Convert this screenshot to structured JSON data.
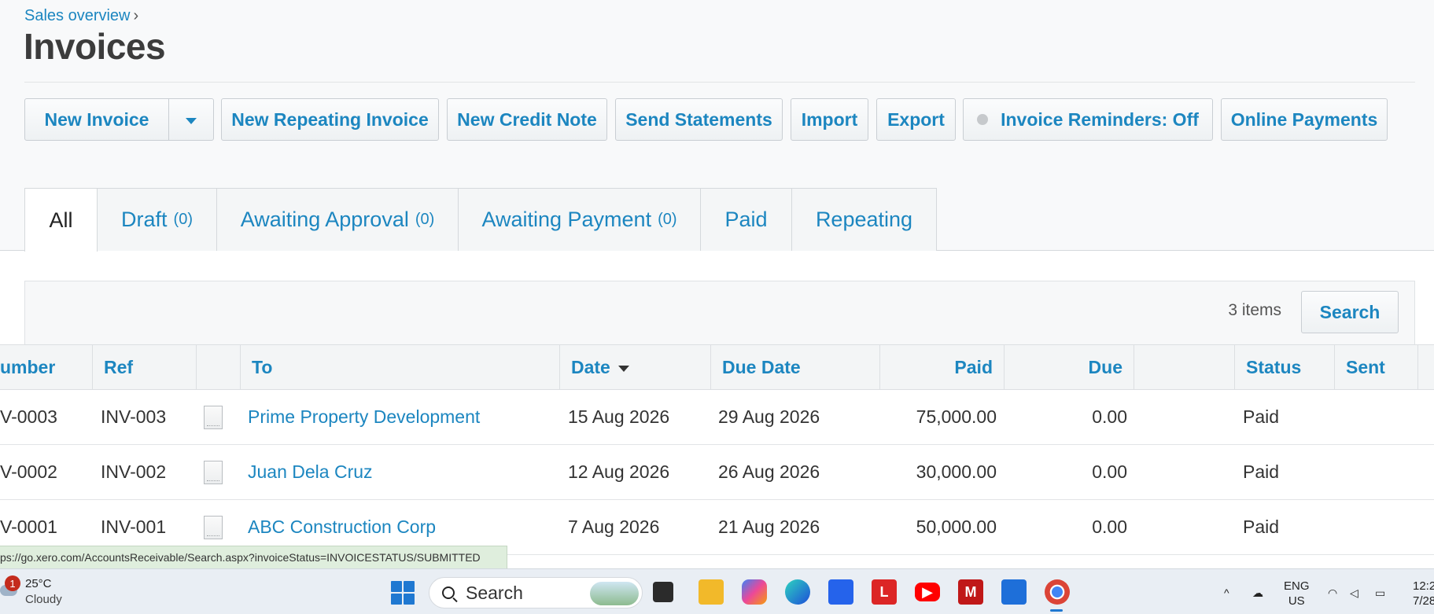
{
  "breadcrumb": {
    "label": "Sales overview",
    "separator": "›"
  },
  "page_title": "Invoices",
  "toolbar": {
    "new_invoice": "New Invoice",
    "new_repeating": "New Repeating Invoice",
    "new_credit_note": "New Credit Note",
    "send_statements": "Send Statements",
    "import": "Import",
    "export": "Export",
    "reminders": "Invoice Reminders: Off",
    "online_payments": "Online Payments"
  },
  "tabs": [
    {
      "label": "All",
      "count": ""
    },
    {
      "label": "Draft",
      "count": "(0)"
    },
    {
      "label": "Awaiting Approval",
      "count": "(0)"
    },
    {
      "label": "Awaiting Payment",
      "count": "(0)"
    },
    {
      "label": "Paid",
      "count": ""
    },
    {
      "label": "Repeating",
      "count": ""
    }
  ],
  "search": {
    "items_count": "3 items",
    "button": "Search"
  },
  "table": {
    "columns": {
      "number": "umber",
      "ref": "Ref",
      "to": "To",
      "date": "Date",
      "due_date": "Due Date",
      "paid": "Paid",
      "due": "Due",
      "status": "Status",
      "sent": "Sent"
    },
    "rows": [
      {
        "number": "V-0003",
        "ref": "INV-003",
        "to": "Prime Property Development",
        "date": "15 Aug 2026",
        "due_date": "29 Aug 2026",
        "paid": "75,000.00",
        "due": "0.00",
        "status": "Paid",
        "sent": ""
      },
      {
        "number": "V-0002",
        "ref": "INV-002",
        "to": "Juan Dela Cruz",
        "date": "12 Aug 2026",
        "due_date": "26 Aug 2026",
        "paid": "30,000.00",
        "due": "0.00",
        "status": "Paid",
        "sent": ""
      },
      {
        "number": "V-0001",
        "ref": "INV-001",
        "to": "ABC Construction Corp",
        "date": "7 Aug 2026",
        "due_date": "21 Aug 2026",
        "paid": "50,000.00",
        "due": "0.00",
        "status": "Paid",
        "sent": ""
      }
    ]
  },
  "status_url": "ps://go.xero.com/AccountsReceivable/Search.aspx?invoiceStatus=INVOICESTATUS/SUBMITTED",
  "taskbar": {
    "weather": {
      "badge": "1",
      "temp": "25°C",
      "condition": "Cloudy"
    },
    "search_label": "Search",
    "apps": [
      "task-view-icon",
      "file-explorer-icon",
      "copilot-icon",
      "edge-icon",
      "store-icon",
      "l-app-icon",
      "youtube-icon",
      "mcafee-icon",
      "remote-desktop-icon",
      "chrome-icon"
    ],
    "lang_line1": "ENG",
    "lang_line2": "US",
    "time": "12:2",
    "date": "7/28"
  },
  "colors": {
    "link": "#1c86c0",
    "taskbar_accent": "#1f78d1"
  }
}
